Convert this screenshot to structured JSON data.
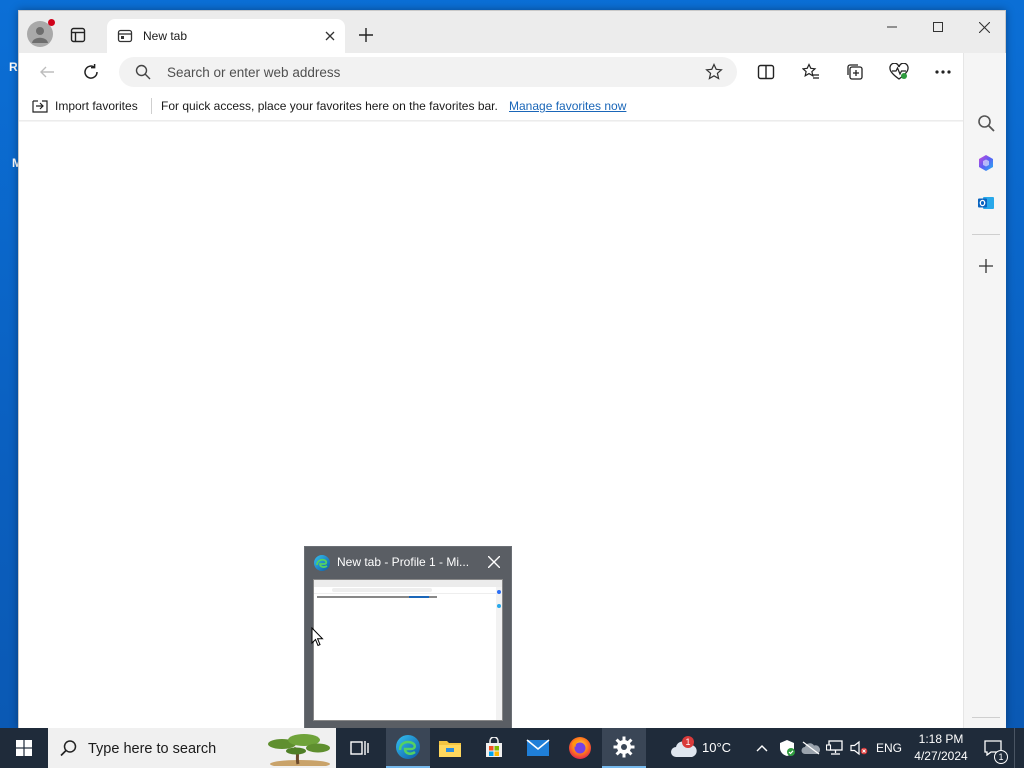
{
  "desktop": {
    "glyph_left_1": "R",
    "glyph_left_2": "M"
  },
  "browser": {
    "tab": {
      "title": "New tab"
    },
    "address_bar": {
      "placeholder": "Search or enter web address"
    },
    "favorites_bar": {
      "import_label": "Import favorites",
      "message": "For quick access, place your favorites here on the favorites bar.",
      "manage_link": "Manage favorites now"
    },
    "colors": {
      "accent": "#1a66b8",
      "titlebar": "#ececec",
      "profile_dot": "#d0021b"
    },
    "toolbar_icons": [
      "back-icon",
      "refresh-icon",
      "favorite-star-icon",
      "split-screen-icon",
      "favorites-icon",
      "collections-icon",
      "browser-essentials-icon",
      "more-icon",
      "copilot-icon"
    ],
    "sidebar_icons": [
      "search-icon",
      "copilot-icon",
      "outlook-icon",
      "add-icon",
      "settings-icon"
    ]
  },
  "taskbar": {
    "search_placeholder": "Type here to search",
    "weather": {
      "temperature": "10°C",
      "badge": "1"
    },
    "language": "ENG",
    "clock": {
      "time": "1:18 PM",
      "date": "4/27/2024"
    },
    "notification_count": "1",
    "apps": [
      "task-view-icon",
      "edge-icon",
      "file-explorer-icon",
      "microsoft-store-icon",
      "mail-icon",
      "firefox-icon",
      "settings-icon"
    ]
  },
  "thumbnail": {
    "title": "New tab - Profile 1 - Mi..."
  }
}
